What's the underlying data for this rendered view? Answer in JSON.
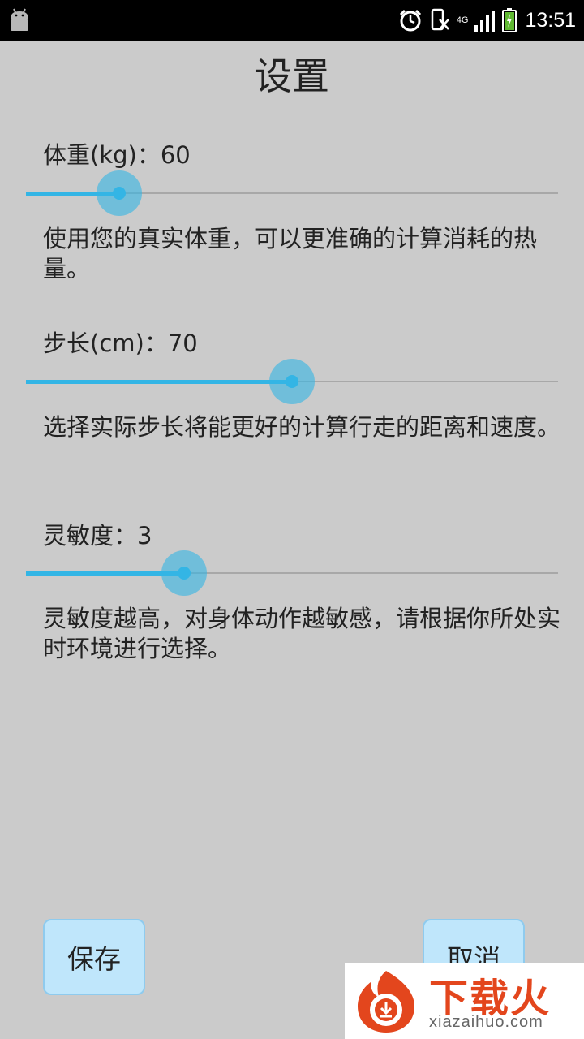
{
  "status_bar": {
    "time": "13:51",
    "network": "4G",
    "icons": [
      "android-icon",
      "alarm-icon",
      "vibrate-icon",
      "signal-icon",
      "battery-charging-icon"
    ]
  },
  "title": "设置",
  "settings": [
    {
      "label": "体重(kg)：60",
      "value": 60,
      "slider_fraction": 0.175,
      "description": "使用您的真实体重，可以更准确的计算消耗的热量。"
    },
    {
      "label": "步长(cm)：70",
      "value": 70,
      "slider_fraction": 0.5,
      "description": "选择实际步长将能更好的计算行走的距离和速度。"
    },
    {
      "label": "灵敏度：3",
      "value": 3,
      "slider_fraction": 0.298,
      "description": "灵敏度越高，对身体动作越敏感，请根据你所处实时环境进行选择。"
    }
  ],
  "buttons": {
    "save": "保存",
    "cancel": "取消"
  },
  "watermark": {
    "cn": "下载火",
    "en": "xiazaihuo.com"
  },
  "colors": {
    "accent": "#33b5e5",
    "background": "#cbcbcb",
    "button_bg": "#bfe6fb",
    "watermark_red": "#e3461d"
  }
}
